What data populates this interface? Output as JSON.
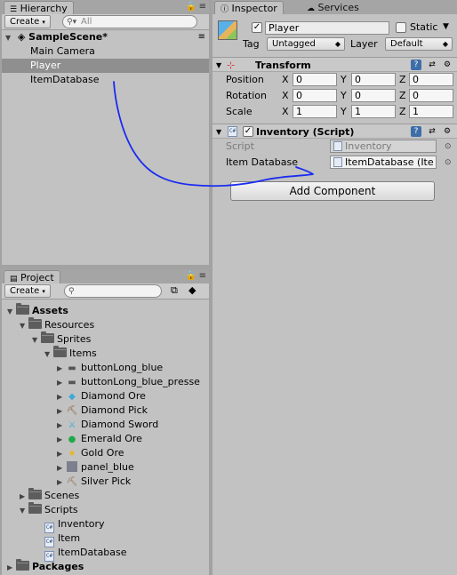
{
  "hierarchy": {
    "tab_label": "Hierarchy",
    "create_label": "Create",
    "search_placeholder": "All",
    "scene_name": "SampleScene*",
    "items": [
      {
        "label": "Main Camera",
        "selected": false
      },
      {
        "label": "Player",
        "selected": true
      },
      {
        "label": "ItemDatabase",
        "selected": false
      }
    ]
  },
  "project": {
    "tab_label": "Project",
    "create_label": "Create",
    "search_placeholder": "",
    "tree": {
      "assets": "Assets",
      "resources": "Resources",
      "sprites": "Sprites",
      "items": "Items",
      "item_assets": [
        {
          "label": "buttonLong_blue",
          "icon": "bar-sprite-icon"
        },
        {
          "label": "buttonLong_blue_presse",
          "icon": "bar-sprite-icon"
        },
        {
          "label": "Diamond Ore",
          "icon": "diamond-ore-icon"
        },
        {
          "label": "Diamond Pick",
          "icon": "pickaxe-icon"
        },
        {
          "label": "Diamond Sword",
          "icon": "sword-icon"
        },
        {
          "label": "Emerald Ore",
          "icon": "emerald-icon"
        },
        {
          "label": "Gold Ore",
          "icon": "gold-ore-icon"
        },
        {
          "label": "panel_blue",
          "icon": "panel-sprite-icon"
        },
        {
          "label": "Silver Pick",
          "icon": "pickaxe-icon"
        }
      ],
      "scenes": "Scenes",
      "scripts": "Scripts",
      "script_files": [
        "Inventory",
        "Item",
        "ItemDatabase"
      ],
      "packages": "Packages"
    }
  },
  "inspector": {
    "tab_label": "Inspector",
    "services_tab_label": "Services",
    "object_name": "Player",
    "static_label": "Static",
    "tag_label": "Tag",
    "tag_value": "Untagged",
    "layer_label": "Layer",
    "layer_value": "Default",
    "transform": {
      "title": "Transform",
      "position_label": "Position",
      "rotation_label": "Rotation",
      "scale_label": "Scale",
      "x": "X",
      "y": "Y",
      "z": "Z",
      "position": [
        "0",
        "0",
        "0"
      ],
      "rotation": [
        "0",
        "0",
        "0"
      ],
      "scale": [
        "1",
        "1",
        "1"
      ]
    },
    "inventory": {
      "title": "Inventory (Script)",
      "script_label": "Script",
      "script_value": "Inventory",
      "item_db_label": "Item Database",
      "item_db_value": "ItemDatabase (Ite"
    },
    "add_component_label": "Add Component"
  },
  "colors": {
    "annotation_stroke": "#1a2cf0",
    "panel_bg": "#c2c2c2",
    "selected_row": "#8f8f8f"
  }
}
